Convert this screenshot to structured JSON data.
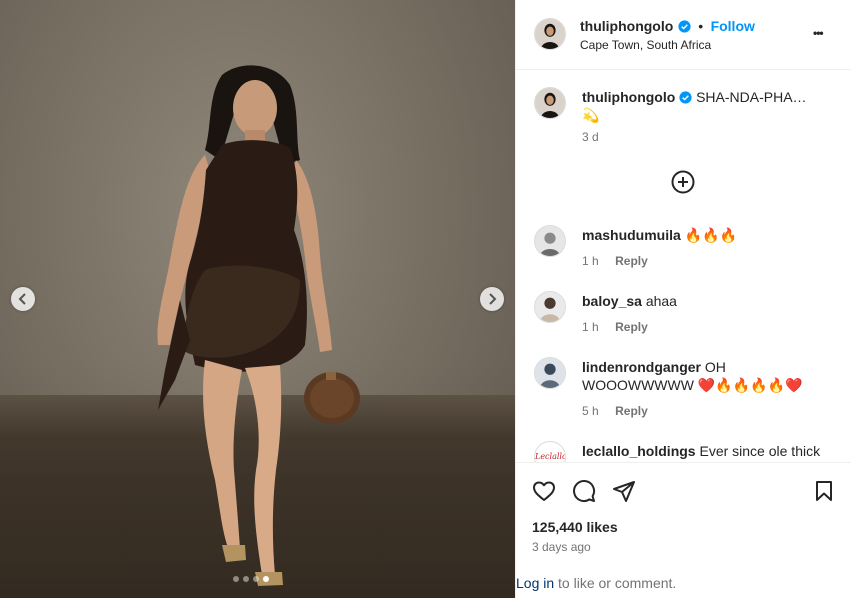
{
  "post": {
    "username": "thuliphongolo",
    "location": "Cape Town, South Africa",
    "follow_label": "Follow",
    "separator": "•",
    "more_label": "•••",
    "caption_user": "thuliphongolo",
    "caption_text": "SHA-NDA-PHA…",
    "caption_emoji": "💫",
    "caption_age": "3 d"
  },
  "comments": [
    {
      "user": "mashudumuila",
      "text": "🔥🔥🔥",
      "age": "1 h",
      "reply": "Reply"
    },
    {
      "user": "baloy_sa",
      "text": "ahaa",
      "age": "1 h",
      "reply": "Reply"
    },
    {
      "user": "lindenrondganger",
      "text": "OH WOOOWWWWW ❤️🔥🔥🔥🔥❤️",
      "age": "5 h",
      "reply": "Reply"
    },
    {
      "user": "leclallo_holdings",
      "text": "Ever since ole thick",
      "avatar_text": "Leclallo"
    }
  ],
  "footer": {
    "likes": "125,440 likes",
    "date": "3 days ago",
    "login_link": "Log in",
    "login_rest": " to like or comment."
  },
  "carousel": {
    "slides": 4,
    "active_index": 3
  },
  "colors": {
    "accent": "#0095f6",
    "verified": "#0095f6",
    "text": "#262626",
    "muted": "#737373"
  }
}
